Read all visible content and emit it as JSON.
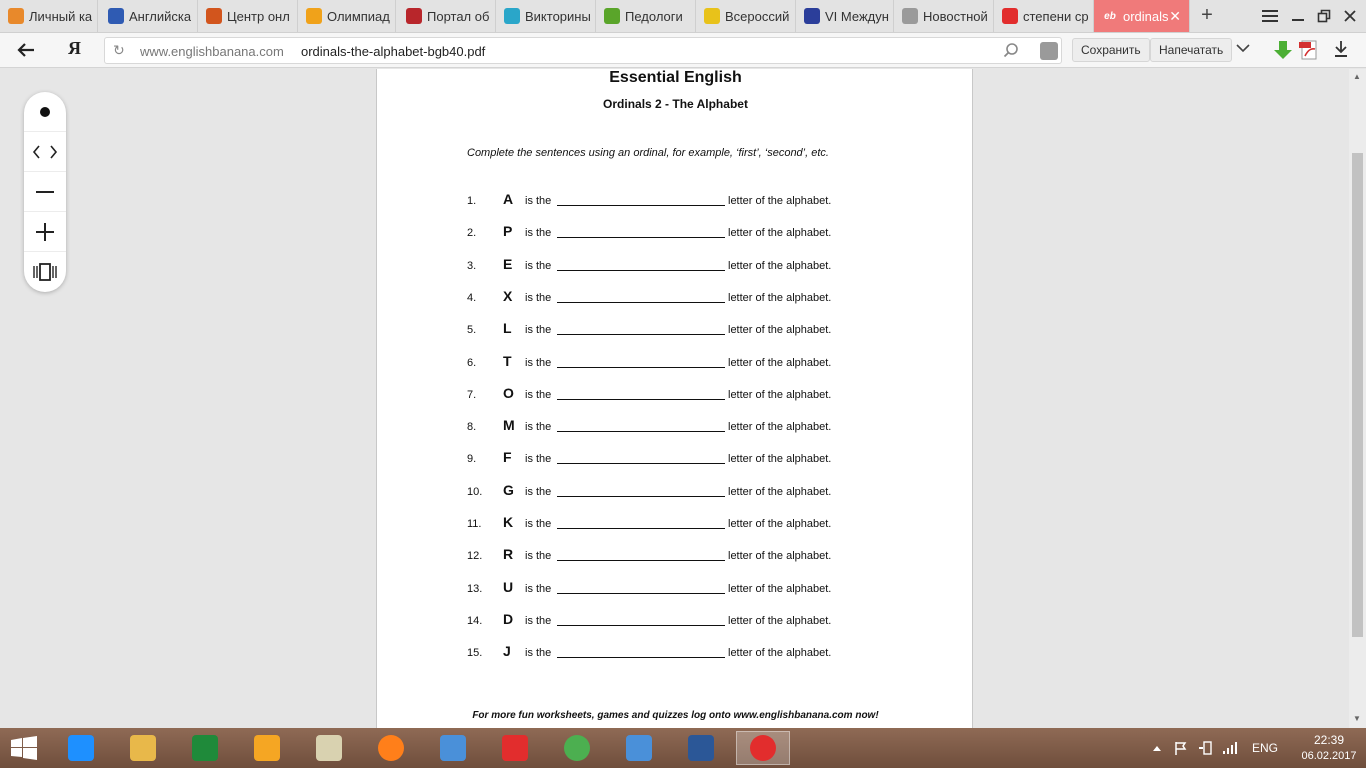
{
  "tabs": [
    {
      "title": "Личный ка",
      "icon": "envelope-icon",
      "color": "#e8892b"
    },
    {
      "title": "Английска",
      "icon": "flag-icon",
      "color": "#2f5bb3"
    },
    {
      "title": "Центр онл",
      "icon": "fox-icon",
      "color": "#d2551d"
    },
    {
      "title": "Олимпиад",
      "icon": "letter-m-icon",
      "color": "#f0a21a"
    },
    {
      "title": "Портал об",
      "icon": "shield-icon",
      "color": "#b8262b"
    },
    {
      "title": "Викторины",
      "icon": "diamond-icon",
      "color": "#2aa6c9"
    },
    {
      "title": "Педологи",
      "icon": "leaf-icon",
      "color": "#5aa52a"
    },
    {
      "title": "Всероссий",
      "icon": "star-icon",
      "color": "#e8c21a"
    },
    {
      "title": "VI Междун",
      "icon": "v-logo-icon",
      "color": "#2b3e9a"
    },
    {
      "title": "Новостной",
      "icon": "news-icon",
      "color": "#9a9a9a"
    },
    {
      "title": "степени ср",
      "icon": "yandex-icon",
      "color": "#e22d2d"
    },
    {
      "title": "ordinals",
      "icon": "eb-icon",
      "color": "#ffffff",
      "active": true
    }
  ],
  "address": {
    "host": "www.englishbanana.com",
    "path": "ordinals-the-alphabet-bgb40.pdf"
  },
  "toolbar": {
    "save_label": "Сохранить",
    "print_label": "Напечатать"
  },
  "document": {
    "title": "Essential English",
    "subtitle": "Ordinals 2 - The Alphabet",
    "instructions": "Complete the sentences using an ordinal, for example, ‘first’, ‘second’, etc.",
    "connector": "is the",
    "tail": "letter of the alphabet.",
    "questions": [
      {
        "num": "1.",
        "letter": "A"
      },
      {
        "num": "2.",
        "letter": "P"
      },
      {
        "num": "3.",
        "letter": "E"
      },
      {
        "num": "4.",
        "letter": "X"
      },
      {
        "num": "5.",
        "letter": "L"
      },
      {
        "num": "6.",
        "letter": "T"
      },
      {
        "num": "7.",
        "letter": "O"
      },
      {
        "num": "8.",
        "letter": "M"
      },
      {
        "num": "9.",
        "letter": "F"
      },
      {
        "num": "10.",
        "letter": "G"
      },
      {
        "num": "11.",
        "letter": "K"
      },
      {
        "num": "12.",
        "letter": "R"
      },
      {
        "num": "13.",
        "letter": "U"
      },
      {
        "num": "14.",
        "letter": "D"
      },
      {
        "num": "15.",
        "letter": "J"
      }
    ],
    "footer": "For more fun worksheets, games and quizzes log onto www.englishbanana.com now!"
  },
  "taskbar": {
    "apps": [
      "ie-icon",
      "file-explorer-icon",
      "excel-icon",
      "chrome-like-icon",
      "notepad-icon",
      "firefox-icon",
      "sound-icon",
      "yandex-icon",
      "chrome-icon",
      "mail-icon",
      "word-icon",
      "yandex-browser-icon"
    ],
    "language": "ENG",
    "time": "22:39",
    "date": "06.02.2017"
  }
}
